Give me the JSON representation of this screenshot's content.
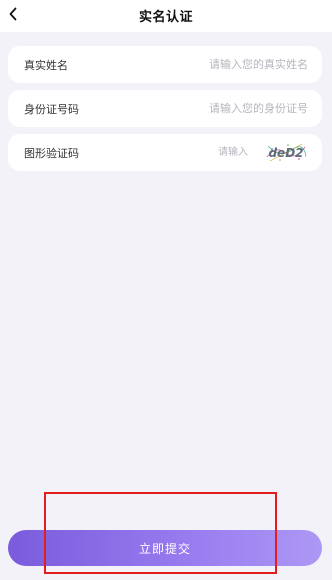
{
  "header": {
    "title": "实名认证",
    "back_icon": "chevron-left-icon"
  },
  "form": {
    "name": {
      "label": "真实姓名",
      "placeholder": "请输入您的真实姓名",
      "value": ""
    },
    "id_number": {
      "label": "身份证号码",
      "placeholder": "请输入您的身份证号",
      "value": ""
    },
    "captcha": {
      "label": "图形验证码",
      "placeholder": "请输入",
      "value": "",
      "image_text": "deD2"
    }
  },
  "submit": {
    "label": "立即提交",
    "gradient_start": "#7a5bdc",
    "gradient_end": "#ad98f5"
  },
  "colors": {
    "page_background": "#f3f2f8",
    "card_background": "#ffffff",
    "highlight": "#e11d1d"
  }
}
